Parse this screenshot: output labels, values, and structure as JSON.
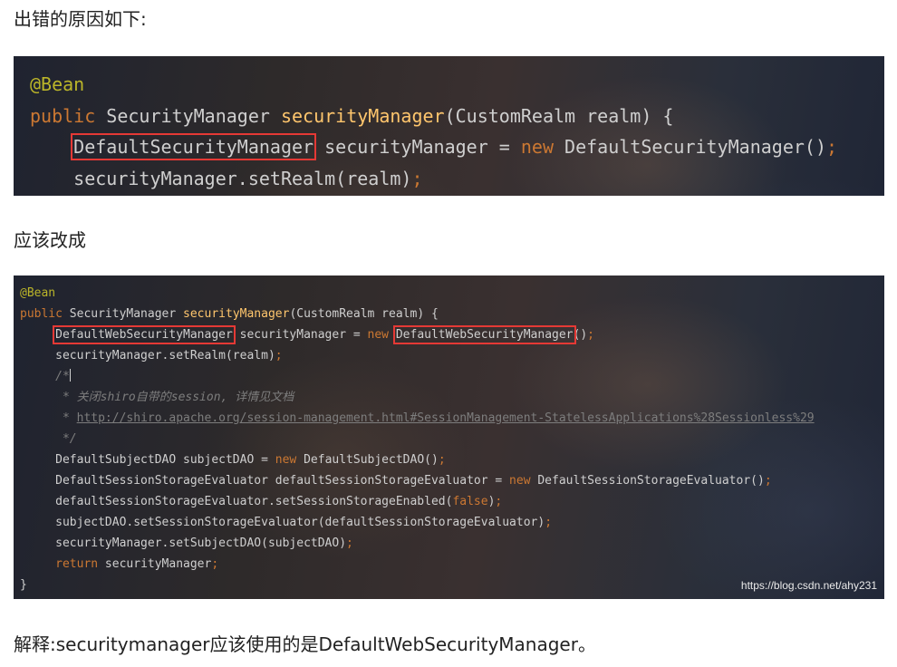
{
  "heading_error": "出错的原因如下:",
  "heading_fix": "应该改成",
  "explanation": "解释:securitymanager应该使用的是DefaultWebSecurityManager。",
  "watermark": "https://blog.csdn.net/ahy231",
  "code1": {
    "l1_annotation": "@Bean",
    "l2_public": "public",
    "l2_type": " SecurityManager ",
    "l2_method": "securityManager",
    "l2_params": "(CustomRealm realm) {",
    "l3_indent": "    ",
    "l3_type": "DefaultSecurityManager",
    "l3_rest": " securityManager = ",
    "l3_new": "new",
    "l3_ctor": " DefaultSecurityManager()",
    "l3_semi": ";",
    "l4_indent": "    ",
    "l4_text": "securityManager.setRealm(realm)",
    "l4_semi": ";"
  },
  "code2": {
    "l1": "@Bean",
    "l2_public": "public",
    "l2_type": " SecurityManager ",
    "l2_method": "securityManager",
    "l2_params": "(CustomRealm realm) {",
    "l3_type": "DefaultWebSecurityManager",
    "l3_mid": " securityManager = ",
    "l3_new": "new",
    "l3_space": " ",
    "l3_ctor": "DefaultWebSecurityManager",
    "l3_paren": "()",
    "l3_semi": ";",
    "l4_text": "securityManager.setRealm(realm)",
    "l4_semi": ";",
    "l5_comment": "/*",
    "l6_comment": " * 关闭shiro自带的session, 详情见文档",
    "l7_prefix": " * ",
    "l7_link": "http://shiro.apache.org/session-management.html#SessionManagement-StatelessApplications%28Sessionless%29",
    "l8_comment": " */",
    "l9_a": "DefaultSubjectDAO subjectDAO = ",
    "l9_new": "new",
    "l9_b": " DefaultSubjectDAO()",
    "l9_semi": ";",
    "l10_a": "DefaultSessionStorageEvaluator defaultSessionStorageEvaluator = ",
    "l10_new": "new",
    "l10_b": " DefaultSessionStorageEvaluator()",
    "l10_semi": ";",
    "l11_a": "defaultSessionStorageEvaluator.setSessionStorageEnabled(",
    "l11_false": "false",
    "l11_b": ")",
    "l11_semi": ";",
    "l12_a": "subjectDAO.setSessionStorageEvaluator(defaultSessionStorageEvaluator)",
    "l12_semi": ";",
    "l13_a": "securityManager.setSubjectDAO(subjectDAO)",
    "l13_semi": ";",
    "l14_return": "return",
    "l14_a": " securityManager",
    "l14_semi": ";",
    "l15": "}"
  }
}
